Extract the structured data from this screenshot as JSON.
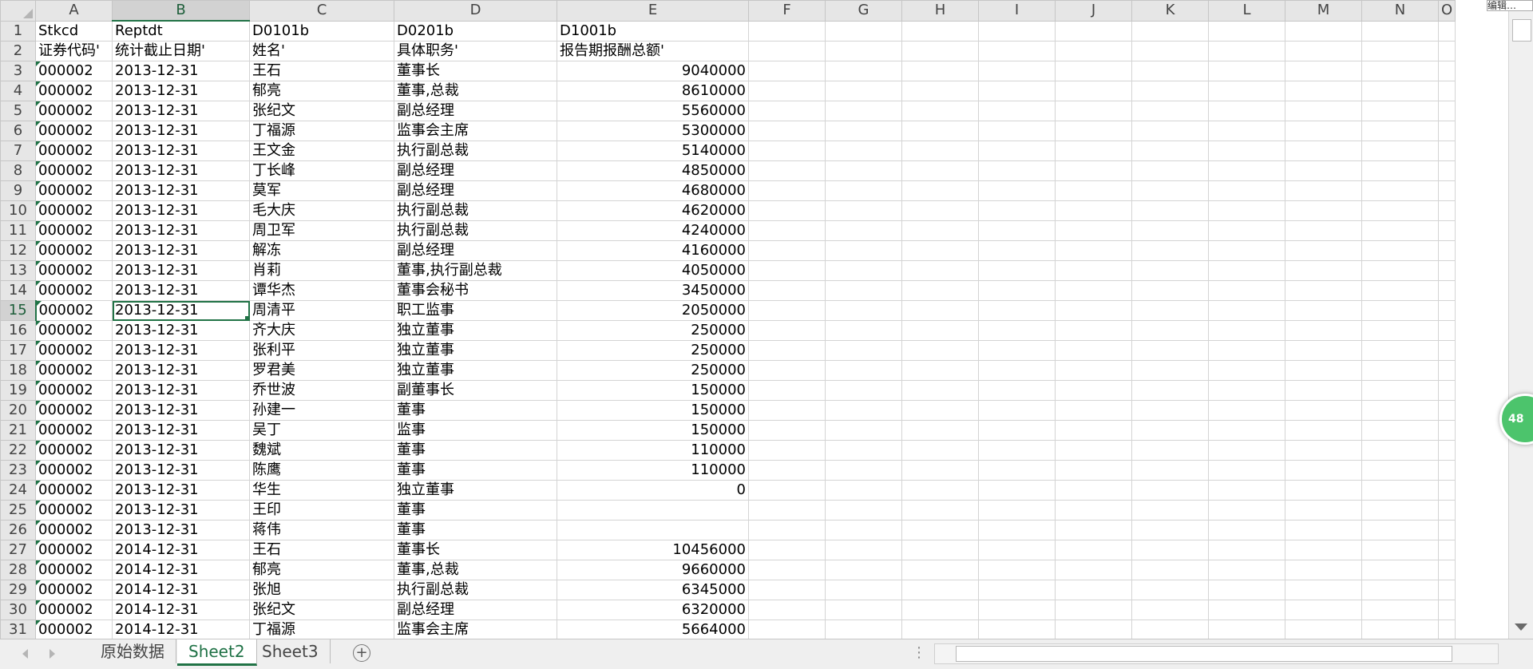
{
  "columns": [
    "A",
    "B",
    "C",
    "D",
    "E",
    "F",
    "G",
    "H",
    "I",
    "J",
    "K",
    "L",
    "M",
    "N",
    "O"
  ],
  "rows": [
    {
      "num": "1",
      "a": "Stkcd",
      "b": "Reptdt",
      "c": "D0101b",
      "d": "D0201b",
      "e": "D1001b",
      "e_num": false
    },
    {
      "num": "2",
      "a": "证券代码'",
      "b": "统计截止日期'",
      "c": "姓名'",
      "d": "具体职务'",
      "e": "报告期报酬总额'",
      "e_num": false
    },
    {
      "num": "3",
      "a": "000002",
      "b": "2013-12-31",
      "c": "王石",
      "d": "董事长",
      "e": "9040000",
      "e_num": true
    },
    {
      "num": "4",
      "a": "000002",
      "b": "2013-12-31",
      "c": "郁亮",
      "d": "董事,总裁",
      "e": "8610000",
      "e_num": true
    },
    {
      "num": "5",
      "a": "000002",
      "b": "2013-12-31",
      "c": "张纪文",
      "d": "副总经理",
      "e": "5560000",
      "e_num": true
    },
    {
      "num": "6",
      "a": "000002",
      "b": "2013-12-31",
      "c": "丁福源",
      "d": "监事会主席",
      "e": "5300000",
      "e_num": true
    },
    {
      "num": "7",
      "a": "000002",
      "b": "2013-12-31",
      "c": "王文金",
      "d": "执行副总裁",
      "e": "5140000",
      "e_num": true
    },
    {
      "num": "8",
      "a": "000002",
      "b": "2013-12-31",
      "c": "丁长峰",
      "d": "副总经理",
      "e": "4850000",
      "e_num": true
    },
    {
      "num": "9",
      "a": "000002",
      "b": "2013-12-31",
      "c": "莫军",
      "d": "副总经理",
      "e": "4680000",
      "e_num": true
    },
    {
      "num": "10",
      "a": "000002",
      "b": "2013-12-31",
      "c": "毛大庆",
      "d": "执行副总裁",
      "e": "4620000",
      "e_num": true
    },
    {
      "num": "11",
      "a": "000002",
      "b": "2013-12-31",
      "c": "周卫军",
      "d": "执行副总裁",
      "e": "4240000",
      "e_num": true
    },
    {
      "num": "12",
      "a": "000002",
      "b": "2013-12-31",
      "c": "解冻",
      "d": "副总经理",
      "e": "4160000",
      "e_num": true
    },
    {
      "num": "13",
      "a": "000002",
      "b": "2013-12-31",
      "c": "肖莉",
      "d": "董事,执行副总裁",
      "e": "4050000",
      "e_num": true
    },
    {
      "num": "14",
      "a": "000002",
      "b": "2013-12-31",
      "c": "谭华杰",
      "d": "董事会秘书",
      "e": "3450000",
      "e_num": true
    },
    {
      "num": "15",
      "a": "000002",
      "b": "2013-12-31",
      "c": "周清平",
      "d": "职工监事",
      "e": "2050000",
      "e_num": true
    },
    {
      "num": "16",
      "a": "000002",
      "b": "2013-12-31",
      "c": "齐大庆",
      "d": "独立董事",
      "e": "250000",
      "e_num": true
    },
    {
      "num": "17",
      "a": "000002",
      "b": "2013-12-31",
      "c": "张利平",
      "d": "独立董事",
      "e": "250000",
      "e_num": true
    },
    {
      "num": "18",
      "a": "000002",
      "b": "2013-12-31",
      "c": "罗君美",
      "d": "独立董事",
      "e": "250000",
      "e_num": true
    },
    {
      "num": "19",
      "a": "000002",
      "b": "2013-12-31",
      "c": "乔世波",
      "d": "副董事长",
      "e": "150000",
      "e_num": true
    },
    {
      "num": "20",
      "a": "000002",
      "b": "2013-12-31",
      "c": "孙建一",
      "d": "董事",
      "e": "150000",
      "e_num": true
    },
    {
      "num": "21",
      "a": "000002",
      "b": "2013-12-31",
      "c": "吴丁",
      "d": "监事",
      "e": "150000",
      "e_num": true
    },
    {
      "num": "22",
      "a": "000002",
      "b": "2013-12-31",
      "c": "魏斌",
      "d": "董事",
      "e": "110000",
      "e_num": true
    },
    {
      "num": "23",
      "a": "000002",
      "b": "2013-12-31",
      "c": "陈鹰",
      "d": "董事",
      "e": "110000",
      "e_num": true
    },
    {
      "num": "24",
      "a": "000002",
      "b": "2013-12-31",
      "c": "华生",
      "d": "独立董事",
      "e": "0",
      "e_num": true
    },
    {
      "num": "25",
      "a": "000002",
      "b": "2013-12-31",
      "c": "王印",
      "d": "董事",
      "e": "",
      "e_num": true
    },
    {
      "num": "26",
      "a": "000002",
      "b": "2013-12-31",
      "c": "蒋伟",
      "d": "董事",
      "e": "",
      "e_num": true
    },
    {
      "num": "27",
      "a": "000002",
      "b": "2014-12-31",
      "c": "王石",
      "d": "董事长",
      "e": "10456000",
      "e_num": true
    },
    {
      "num": "28",
      "a": "000002",
      "b": "2014-12-31",
      "c": "郁亮",
      "d": "董事,总裁",
      "e": "9660000",
      "e_num": true
    },
    {
      "num": "29",
      "a": "000002",
      "b": "2014-12-31",
      "c": "张旭",
      "d": "执行副总裁",
      "e": "6345000",
      "e_num": true
    },
    {
      "num": "30",
      "a": "000002",
      "b": "2014-12-31",
      "c": "张纪文",
      "d": "副总经理",
      "e": "6320000",
      "e_num": true
    },
    {
      "num": "31",
      "a": "000002",
      "b": "2014-12-31",
      "c": "丁福源",
      "d": "监事会主席",
      "e": "5664000",
      "e_num": true
    }
  ],
  "selected_cell": {
    "row": "15",
    "col": "B"
  },
  "tabs": [
    "原始数据",
    "Sheet2",
    "Sheet3"
  ],
  "active_tab": "Sheet2",
  "add_sheet_label": "+",
  "tab_bar_menu_dots": "⋮",
  "float_badge_text": "48",
  "tooltip_text": "编辑…",
  "colors": {
    "accent": "#217346",
    "header_bg": "#e6e6e6",
    "gridline": "#d4d4d4",
    "badge": "#4cc46c"
  }
}
